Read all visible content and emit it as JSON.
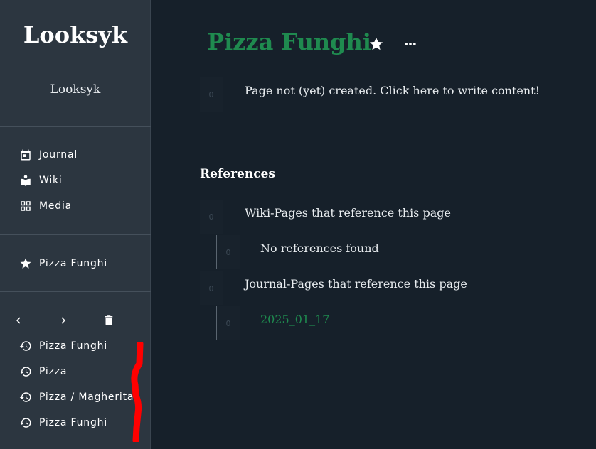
{
  "sidebar": {
    "app_title": "Looksyk",
    "app_subtitle": "Looksyk",
    "nav": [
      {
        "label": "Journal",
        "icon": "calendar-icon"
      },
      {
        "label": "Wiki",
        "icon": "book-reader-icon"
      },
      {
        "label": "Media",
        "icon": "grid-icon"
      }
    ],
    "favorites": [
      {
        "label": "Pizza Funghi",
        "icon": "star-icon"
      }
    ],
    "history_controls": {
      "back": "chevron-left-icon",
      "forward": "chevron-right-icon",
      "clear": "trash-icon"
    },
    "history": [
      {
        "label": "Pizza Funghi",
        "icon": "history-icon"
      },
      {
        "label": "Pizza",
        "icon": "history-icon"
      },
      {
        "label": "Pizza / Magherita",
        "icon": "history-icon"
      },
      {
        "label": "Pizza Funghi",
        "icon": "history-icon"
      }
    ]
  },
  "main": {
    "page_title": "Pizza Funghi",
    "favorite_icon": "star-icon",
    "more_icon": "more-horizontal-icon",
    "blocks": [
      {
        "handle": "0",
        "text": "Page not (yet) created. Click here to write content!"
      }
    ],
    "references": {
      "heading": "References",
      "wiki": {
        "handle": "0",
        "label": "Wiki-Pages that reference this page",
        "child_handle": "0",
        "child_text": "No references found"
      },
      "journal": {
        "handle": "0",
        "label": "Journal-Pages that reference this page",
        "child_handle": "0",
        "child_text": "2025_01_17"
      }
    }
  },
  "colors": {
    "background": "#16202a",
    "sidebar": "#2c3640",
    "accent_green": "#1f8a4f",
    "annotation_red": "#ff0000"
  }
}
